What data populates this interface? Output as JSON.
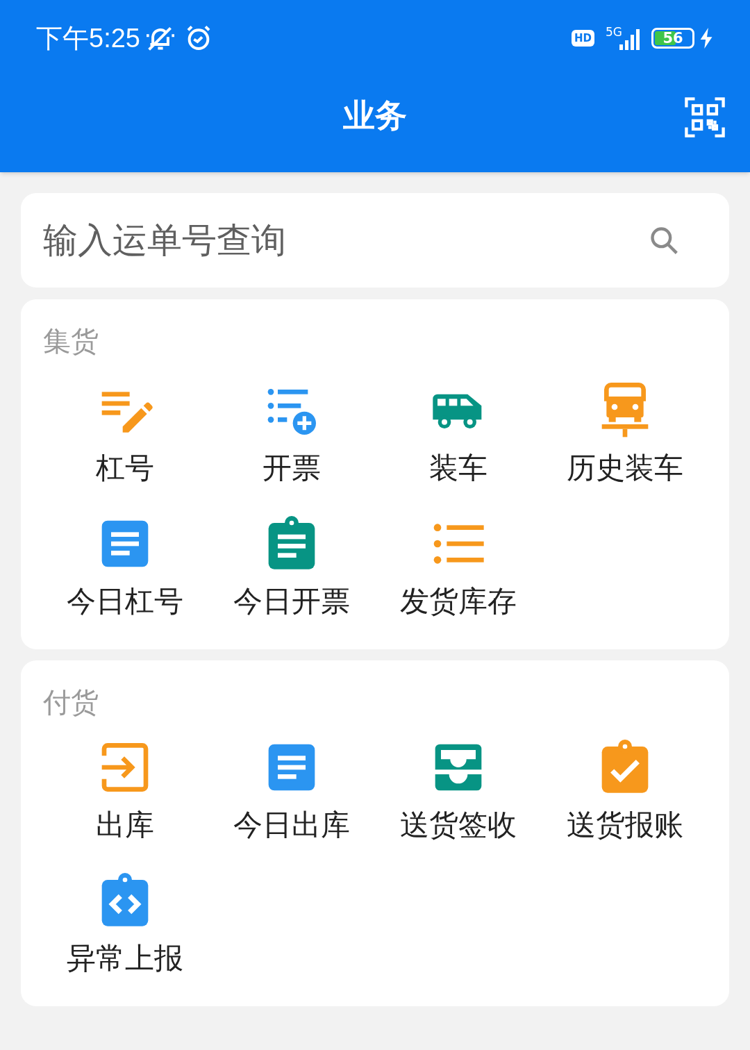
{
  "status_bar": {
    "time": "下午5:25",
    "hd": "HD",
    "network": "5G",
    "battery": "56"
  },
  "header": {
    "title": "业务"
  },
  "search": {
    "placeholder": "输入运单号查询"
  },
  "sections": [
    {
      "title": "集货",
      "items": [
        {
          "label": "杠号",
          "kind": "notes-edit",
          "color": "#f7981c"
        },
        {
          "label": "开票",
          "kind": "list-add",
          "color": "#2b95f1"
        },
        {
          "label": "装车",
          "kind": "van",
          "color": "#079484"
        },
        {
          "label": "历史装车",
          "kind": "car-lift",
          "color": "#f7981c"
        },
        {
          "label": "今日杠号",
          "kind": "doc",
          "color": "#2b95f1"
        },
        {
          "label": "今日开票",
          "kind": "clipboard-doc",
          "color": "#079484"
        },
        {
          "label": "发货库存",
          "kind": "bullets",
          "color": "#f7981c"
        }
      ]
    },
    {
      "title": "付货",
      "items": [
        {
          "label": "出库",
          "kind": "login",
          "color": "#f7981c"
        },
        {
          "label": "今日出库",
          "kind": "doc",
          "color": "#2b95f1"
        },
        {
          "label": "送货签收",
          "kind": "tray",
          "color": "#079484"
        },
        {
          "label": "送货报账",
          "kind": "clipboard-check",
          "color": "#f7981c"
        },
        {
          "label": "异常上报",
          "kind": "clipboard-code",
          "color": "#2b95f1"
        }
      ]
    }
  ]
}
